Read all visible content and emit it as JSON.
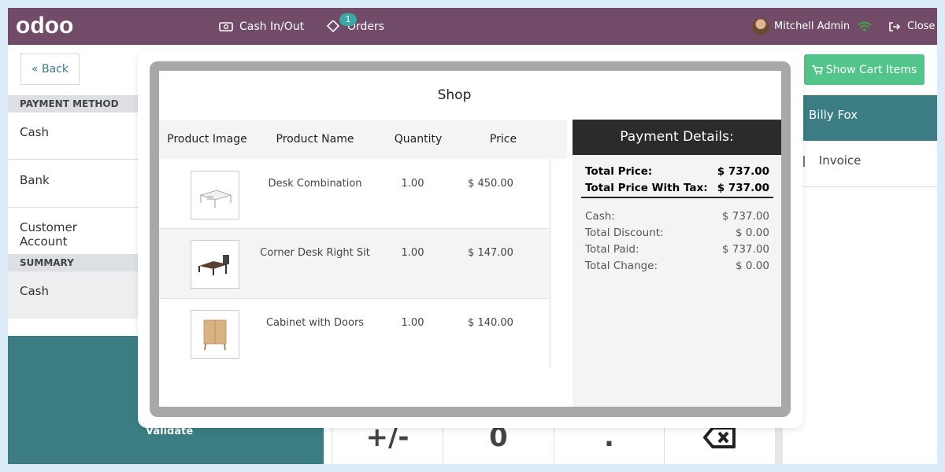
{
  "topbar": {
    "logo": "odoo",
    "cash_in_out": "Cash In/Out",
    "orders": "Orders",
    "orders_badge": "1",
    "user_name": "Mitchell Admin",
    "close": "Close"
  },
  "left_panel": {
    "back": "« Back",
    "payment_method_heading": "PAYMENT METHOD",
    "methods": [
      "Cash",
      "Bank",
      "Customer Account"
    ],
    "summary_heading": "SUMMARY",
    "summary_item": "Cash",
    "validate": "Validate"
  },
  "numpad": {
    "keys": [
      "+/-",
      "0",
      "."
    ],
    "backspace_icon": "backspace-icon"
  },
  "right_panel": {
    "show_cart": "Show Cart Items",
    "customer": "Billy Fox",
    "invoice": "Invoice"
  },
  "modal": {
    "title": "Shop",
    "columns": [
      "Product Image",
      "Product Name",
      "Quantity",
      "Price"
    ],
    "rows": [
      {
        "name": "Desk Combination",
        "qty": "1.00",
        "price": "$ 450.00",
        "image": "desk-combination-image"
      },
      {
        "name": "Corner Desk Right Sit",
        "qty": "1.00",
        "price": "$ 147.00",
        "image": "corner-desk-image"
      },
      {
        "name": "Cabinet with Doors",
        "qty": "1.00",
        "price": "$ 140.00",
        "image": "cabinet-image"
      }
    ],
    "payment": {
      "heading": "Payment Details:",
      "total_price_label": "Total Price:",
      "total_price": "$ 737.00",
      "total_tax_label": "Total Price With Tax:",
      "total_tax": "$ 737.00",
      "cash_label": "Cash:",
      "cash": "$ 737.00",
      "discount_label": "Total Discount:",
      "discount": "$ 0.00",
      "paid_label": "Total Paid:",
      "paid": "$ 737.00",
      "change_label": "Total Change:",
      "change": "$ 0.00"
    }
  },
  "colors": {
    "brand": "#714b67",
    "teal": "#3b7d82",
    "green": "#52c58a"
  }
}
